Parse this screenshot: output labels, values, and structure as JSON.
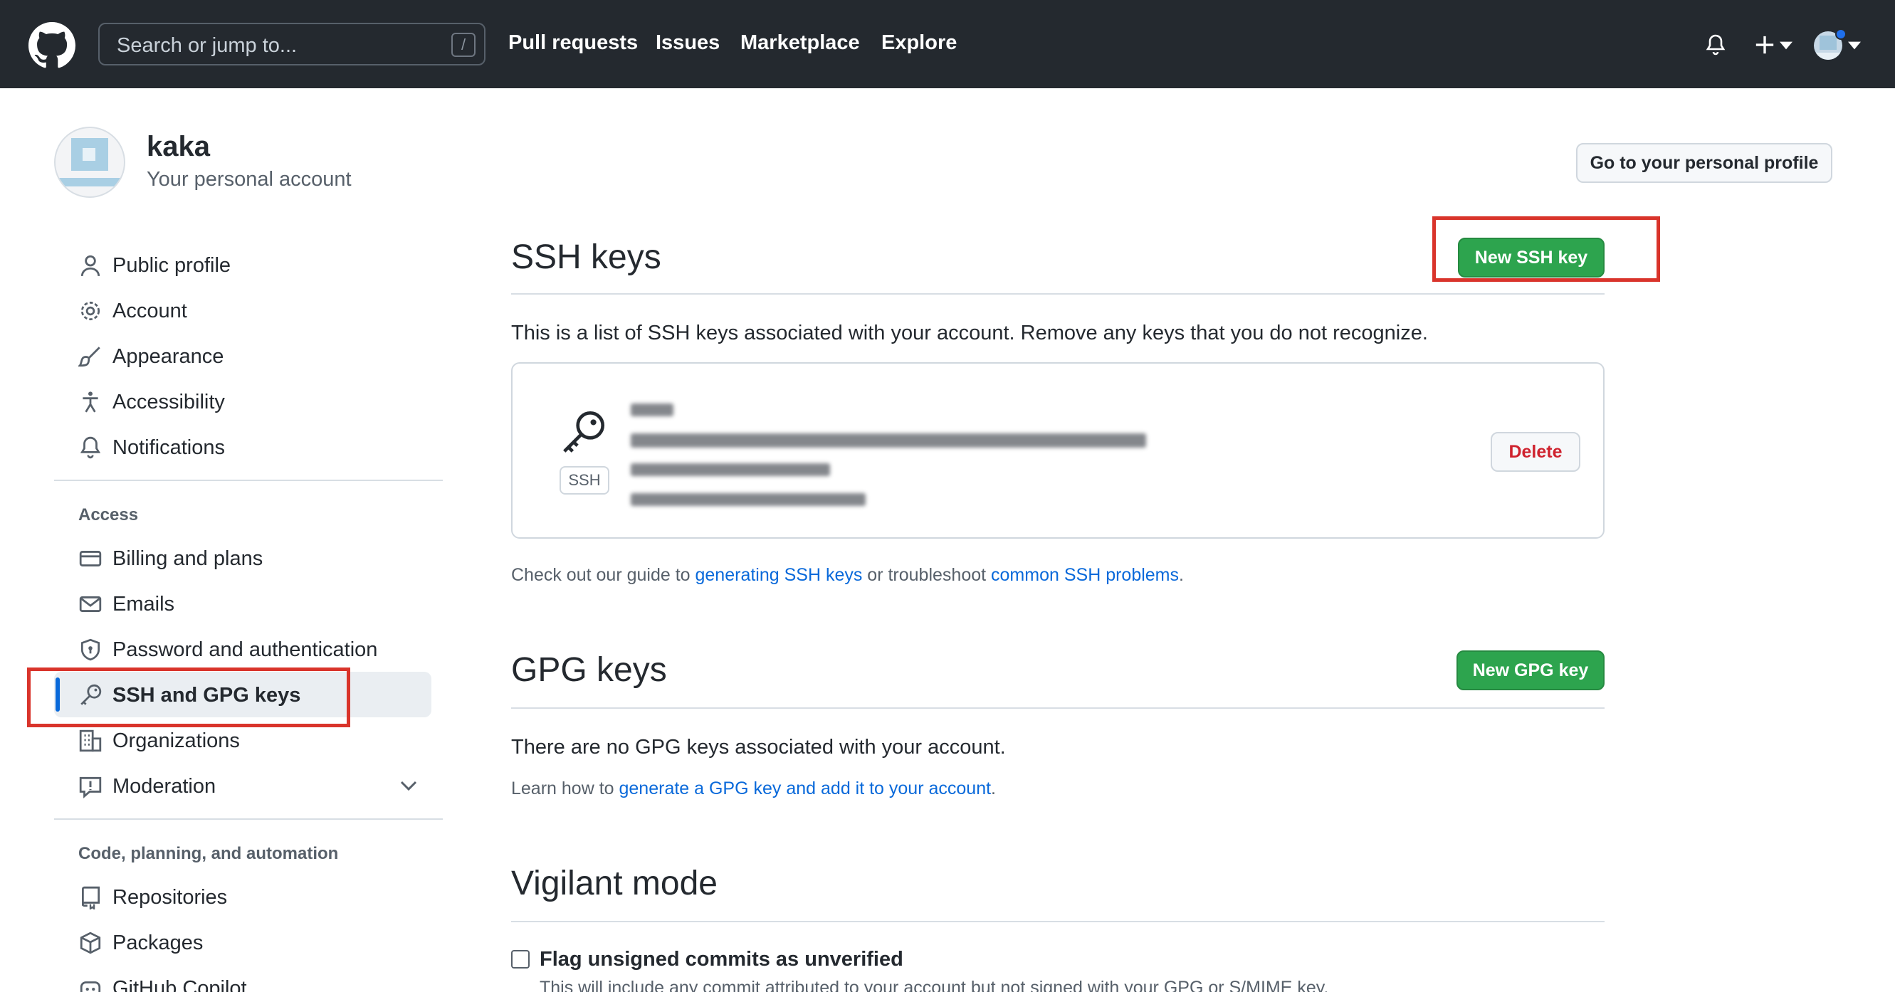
{
  "header": {
    "search_placeholder": "Search or jump to...",
    "search_shortcut": "/",
    "nav": [
      "Pull requests",
      "Issues",
      "Marketplace",
      "Explore"
    ]
  },
  "account": {
    "name": "kaka",
    "subtitle": "Your personal account",
    "profile_button": "Go to your personal profile"
  },
  "sidebar": {
    "items_top": [
      {
        "label": "Public profile",
        "icon": "person-icon"
      },
      {
        "label": "Account",
        "icon": "gear-icon"
      },
      {
        "label": "Appearance",
        "icon": "paintbrush-icon"
      },
      {
        "label": "Accessibility",
        "icon": "accessibility-icon"
      },
      {
        "label": "Notifications",
        "icon": "bell-icon"
      }
    ],
    "group_access": "Access",
    "items_access": [
      {
        "label": "Billing and plans",
        "icon": "credit-card-icon"
      },
      {
        "label": "Emails",
        "icon": "mail-icon"
      },
      {
        "label": "Password and authentication",
        "icon": "shield-lock-icon"
      },
      {
        "label": "SSH and GPG keys",
        "icon": "key-icon",
        "selected": true
      },
      {
        "label": "Organizations",
        "icon": "organization-icon"
      },
      {
        "label": "Moderation",
        "icon": "report-icon"
      }
    ],
    "group_code": "Code, planning, and automation",
    "items_code": [
      {
        "label": "Repositories",
        "icon": "repo-icon"
      },
      {
        "label": "Packages",
        "icon": "package-icon"
      },
      {
        "label": "GitHub Copilot",
        "icon": "copilot-icon"
      }
    ]
  },
  "ssh": {
    "title": "SSH keys",
    "new_button": "New SSH key",
    "description": "This is a list of SSH keys associated with your account. Remove any keys that you do not recognize.",
    "key_type_label": "SSH",
    "delete_button": "Delete",
    "guide_prefix": "Check out our guide to ",
    "guide_link1": "generating SSH keys",
    "guide_mid": " or troubleshoot ",
    "guide_link2": "common SSH problems",
    "guide_suffix": "."
  },
  "gpg": {
    "title": "GPG keys",
    "new_button": "New GPG key",
    "description": "There are no GPG keys associated with your account.",
    "learn_prefix": "Learn how to ",
    "learn_link": "generate a GPG key and add it to your account",
    "learn_suffix": "."
  },
  "vigilant": {
    "title": "Vigilant mode",
    "checkbox_label": "Flag unsigned commits as unverified",
    "checkbox_help": "This will include any commit attributed to your account but not signed with your GPG or S/MIME key."
  },
  "colors": {
    "header_bg": "#24292f",
    "primary_green": "#2da44e",
    "link_blue": "#0969da",
    "danger_red": "#cf222e",
    "annotation_red": "#d9342b"
  }
}
